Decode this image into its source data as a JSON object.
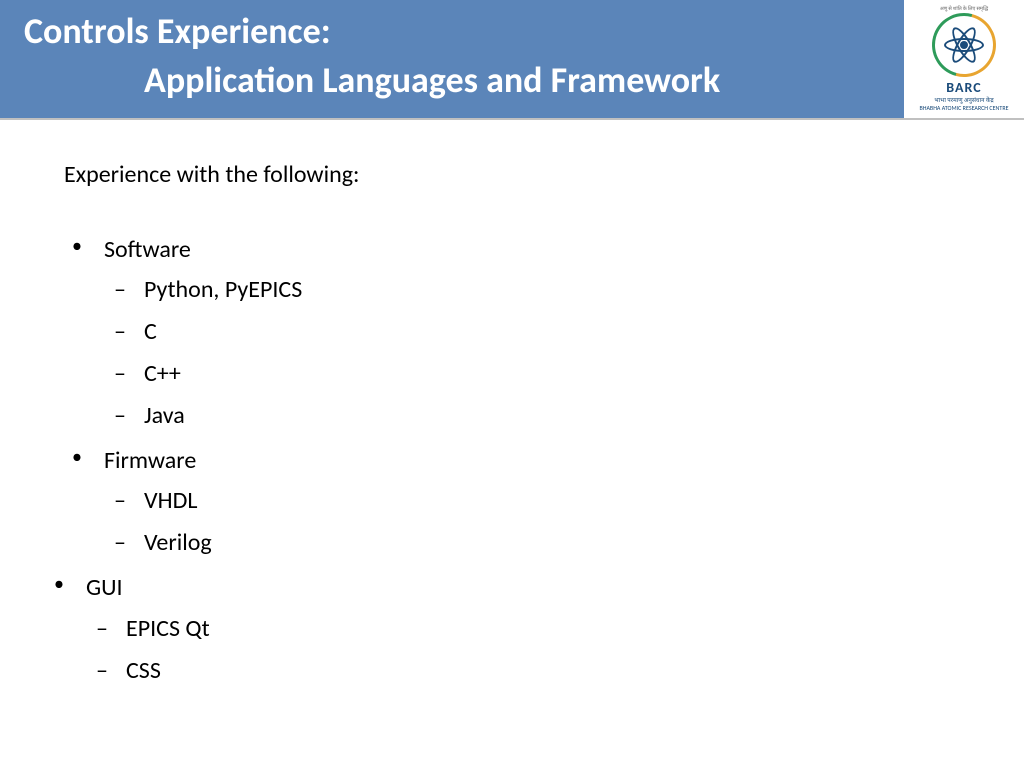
{
  "header": {
    "title_line1": "Controls Experience:",
    "title_line2": "Application Languages and Framework",
    "logo": {
      "top_text": "अणु से शांति के लिए समृद्धि",
      "name": "BARC",
      "subtext": "भाभा परमाणु अनुसंधान केंद्र",
      "subtext2": "BHABHA ATOMIC RESEARCH CENTRE"
    }
  },
  "content": {
    "intro": "Experience with the following:",
    "sections": [
      {
        "label": "Software",
        "items": [
          "Python, PyEPICS",
          "C",
          "C++",
          "Java"
        ]
      },
      {
        "label": "Firmware",
        "items": [
          "VHDL",
          "Verilog"
        ]
      },
      {
        "label": "GUI",
        "items": [
          "EPICS Qt",
          "CSS"
        ]
      }
    ]
  }
}
